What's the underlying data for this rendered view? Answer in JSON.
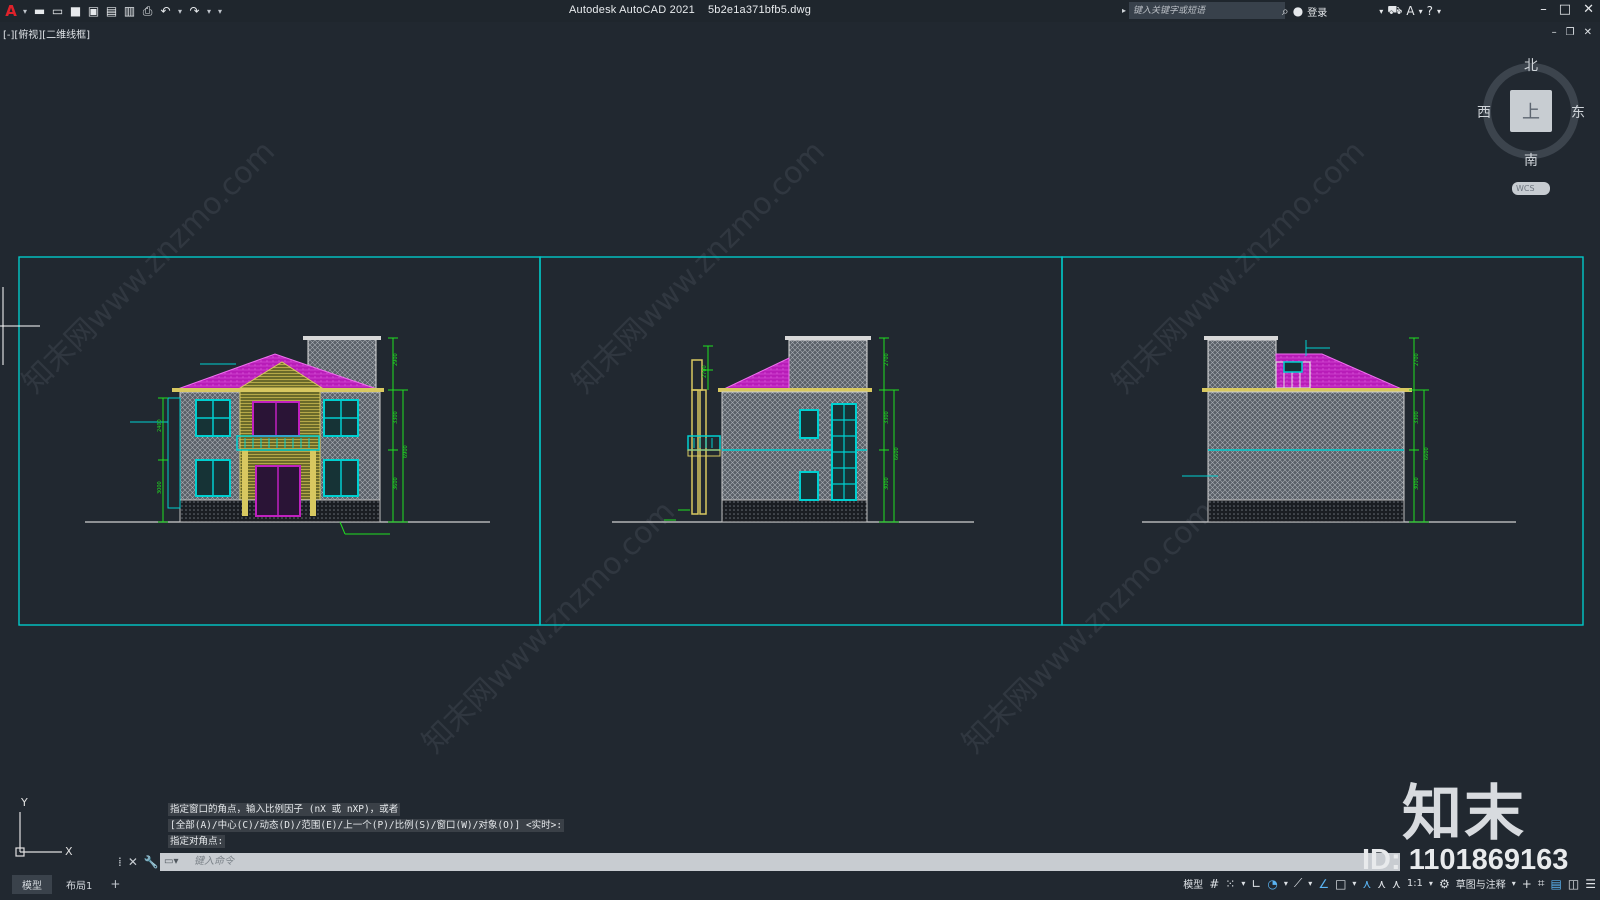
{
  "titlebar": {
    "app_title": "Autodesk AutoCAD 2021",
    "file_name": "5b2e1a371bfb5.dwg",
    "search_placeholder": "键入关键字或短语",
    "login_label": "登录"
  },
  "viewport": {
    "label": "[-][俯视][二维线框]"
  },
  "viewcube": {
    "north": "北",
    "south": "南",
    "east": "东",
    "west": "西",
    "face": "上",
    "wcs": "WCS"
  },
  "ucs": {
    "x_label": "X",
    "y_label": "Y"
  },
  "command": {
    "history": [
      "指定窗口的角点，输入比例因子 (nX 或 nXP)，或者",
      "[全部(A)/中心(C)/动态(D)/范围(E)/上一个(P)/比例(S)/窗口(W)/对象(O)] <实时>:",
      "指定对角点:"
    ],
    "input_placeholder": "键入命令"
  },
  "layout_tabs": [
    "模型",
    "布局1"
  ],
  "statusbar": {
    "model_label": "模型",
    "scale_label": "1:1",
    "workspace_label": "草图与注释"
  },
  "watermark": {
    "text": "知末网www.znzmo.com",
    "brand": "知末",
    "id": "ID: 1101869163"
  },
  "drawing": {
    "dims_front": [
      "2900",
      "3300",
      "3600",
      "6900",
      "2400",
      "3000"
    ],
    "dims_side": [
      "2700",
      "3300",
      "6600",
      "3000",
      "2700"
    ],
    "dims_rear": [
      "2700",
      "3300",
      "6600",
      "3000"
    ]
  },
  "colors": {
    "background": "#212830",
    "frame": "#00c8c8",
    "roof": "#c020c0",
    "dimension": "#20e020",
    "wall_hatch": "#9aa0a6",
    "wood_siding": "#b0a040"
  }
}
